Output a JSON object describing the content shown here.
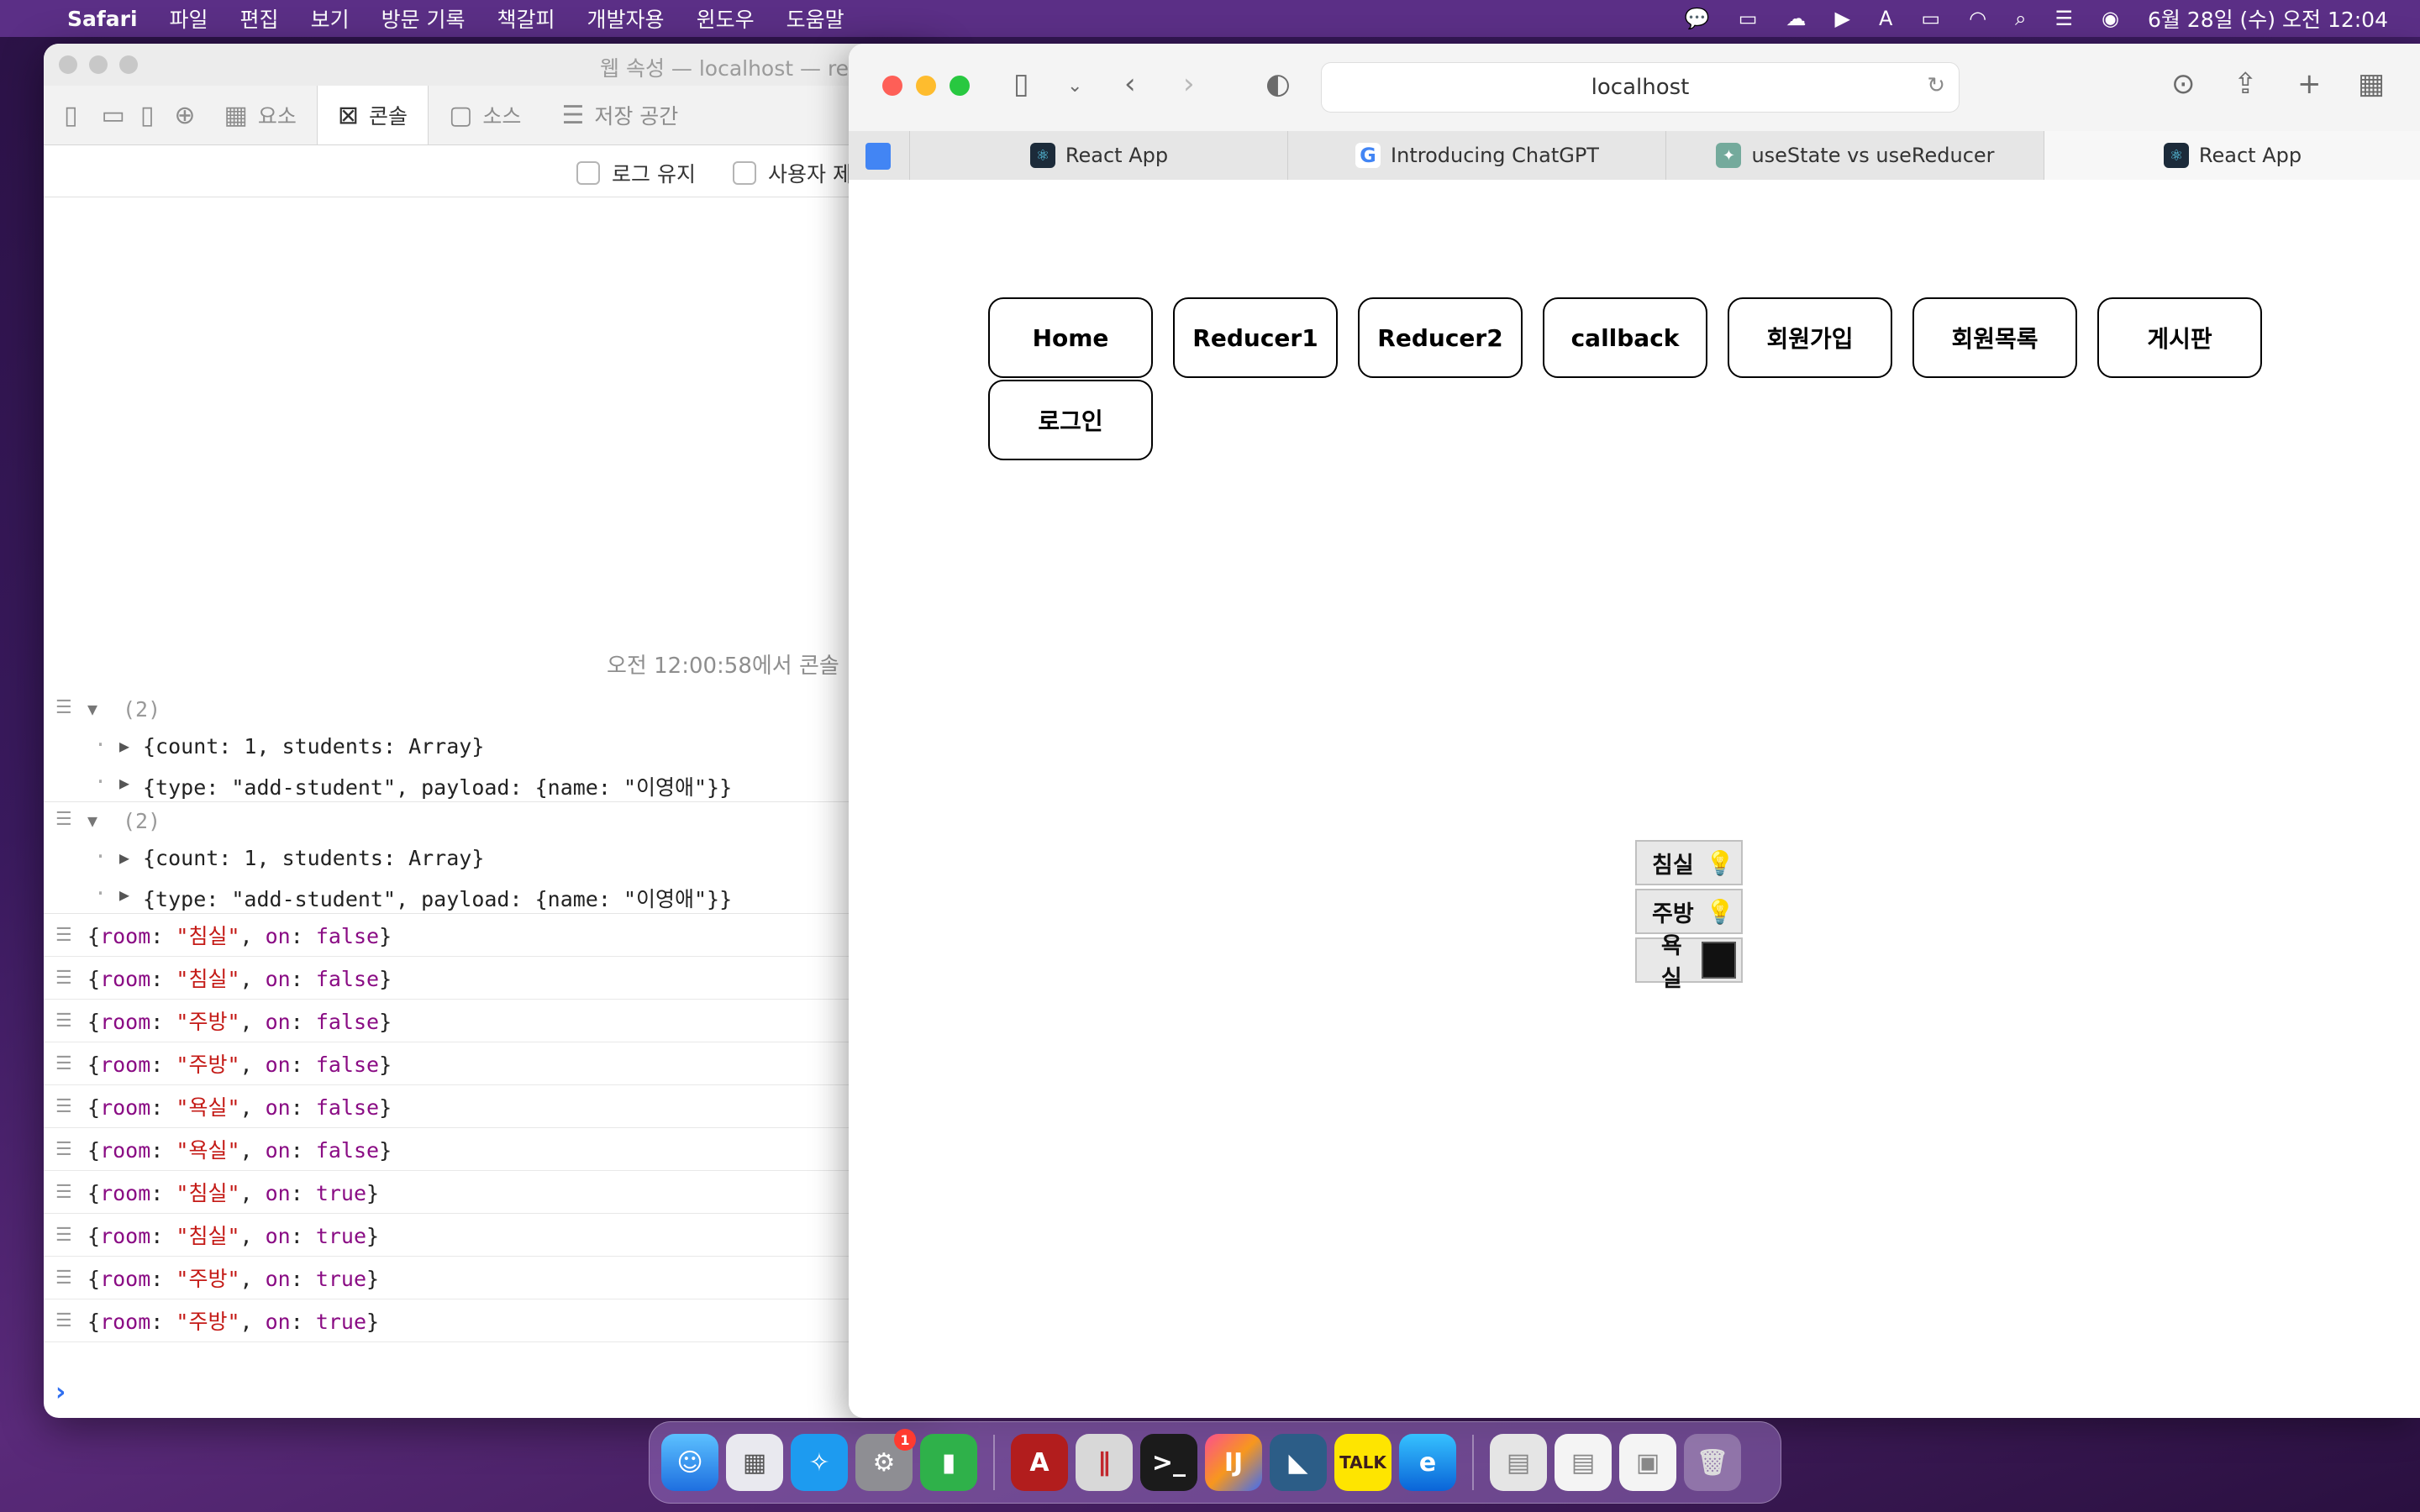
{
  "menubar": {
    "app": "Safari",
    "items": [
      "파일",
      "편집",
      "보기",
      "방문 기록",
      "책갈피",
      "개발자용",
      "윈도우",
      "도움말"
    ],
    "clock": "6월 28일 (수) 오전 12:04"
  },
  "inspector": {
    "title": "웹 속성 — localhost — re",
    "tabs": [
      "요소",
      "콘솔",
      "소스",
      "저장 공간"
    ],
    "active_tab": "콘솔",
    "checkbox_preserve_log": "로그 유지",
    "checkbox_user": "사용자 제",
    "cleared_note": "오전 12:00:58에서 콘솔",
    "groups": [
      {
        "header": "(2)",
        "rows": [
          "{count: 1, students: Array}",
          "{type: \"add-student\", payload: {name: \"이영애\"}}"
        ]
      },
      {
        "header": "(2)",
        "rows": [
          "{count: 1, students: Array}",
          "{type: \"add-student\", payload: {name: \"이영애\"}}"
        ]
      }
    ],
    "logs": [
      {
        "room": "침실",
        "on": "false"
      },
      {
        "room": "침실",
        "on": "false"
      },
      {
        "room": "주방",
        "on": "false"
      },
      {
        "room": "주방",
        "on": "false"
      },
      {
        "room": "욕실",
        "on": "false"
      },
      {
        "room": "욕실",
        "on": "false"
      },
      {
        "room": "침실",
        "on": "true"
      },
      {
        "room": "침실",
        "on": "true"
      },
      {
        "room": "주방",
        "on": "true"
      },
      {
        "room": "주방",
        "on": "true"
      }
    ]
  },
  "safari": {
    "url": "localhost",
    "tabs": [
      {
        "title": "React App",
        "favicon": "react-icon"
      },
      {
        "title": "Introducing ChatGPT",
        "favicon": "google-icon"
      },
      {
        "title": "useState vs useReducer",
        "favicon": "chatgpt-icon"
      },
      {
        "title": "React App",
        "favicon": "react-icon"
      }
    ],
    "nav_buttons": [
      "Home",
      "Reducer1",
      "Reducer2",
      "callback",
      "회원가입",
      "회원목록",
      "게시판",
      "로그인"
    ],
    "rooms": [
      {
        "name": "침실",
        "state": "on"
      },
      {
        "name": "주방",
        "state": "on"
      },
      {
        "name": "욕실",
        "state": "off"
      }
    ]
  },
  "dock": {
    "apps": [
      "Finder",
      "Launchpad",
      "Safari",
      "System Settings",
      "Numbers",
      "Acrobat",
      "Parallels",
      "Terminal",
      "IntelliJ IDEA",
      "MySQL Workbench",
      "KakaoTalk",
      "Edge",
      "Documents",
      "Preview",
      "Preview 2",
      "Trash"
    ],
    "settings_badge": "1"
  }
}
